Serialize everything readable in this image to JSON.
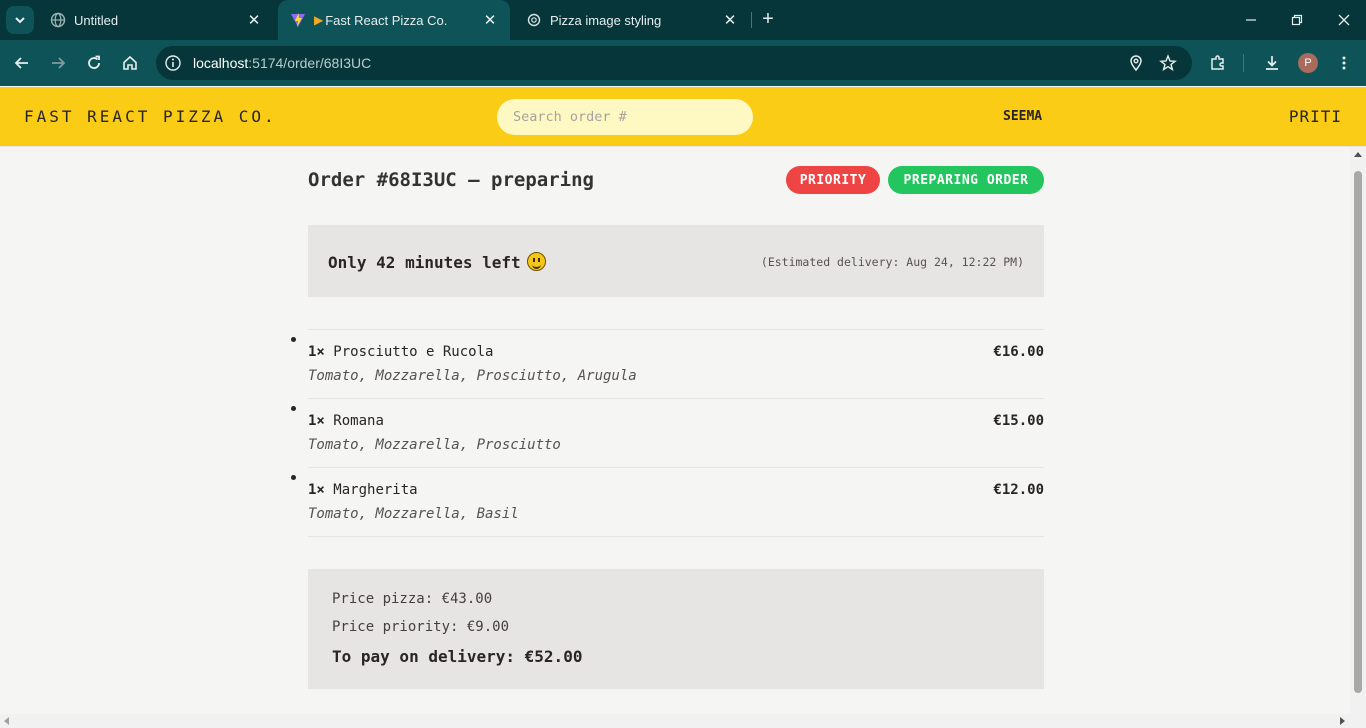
{
  "browser": {
    "tabs": [
      {
        "title": "Untitled",
        "icon": "globe-icon",
        "active": false
      },
      {
        "title": "Fast React Pizza Co.",
        "icon": "vite-icon",
        "active": true
      },
      {
        "title": "Pizza image styling",
        "icon": "openai-icon",
        "active": false
      }
    ],
    "url_host": "localhost",
    "url_path": ":5174/order/68I3UC",
    "profile_initial": "P"
  },
  "header": {
    "logo": "FAST REACT PIZZA CO.",
    "search_placeholder": "Search order #",
    "username": "SEEMA",
    "username_secondary": "PRITI"
  },
  "order": {
    "title": "Order #68I3UC — preparing",
    "priority_badge": "PRIORITY",
    "status_badge": "PREPARING ORDER",
    "eta": "Only 42 minutes left",
    "eta_emoji": "grinning-face-emoji",
    "estimated_delivery": "(Estimated delivery: Aug 24, 12:22 PM)",
    "items": [
      {
        "qty": "1×",
        "name": "Prosciutto e Rucola",
        "price": "€16.00",
        "ingredients": "Tomato, Mozzarella, Prosciutto, Arugula"
      },
      {
        "qty": "1×",
        "name": "Romana",
        "price": "€15.00",
        "ingredients": "Tomato, Mozzarella, Prosciutto"
      },
      {
        "qty": "1×",
        "name": "Margherita",
        "price": "€12.00",
        "ingredients": "Tomato, Mozzarella, Basil"
      }
    ],
    "price_pizza": "Price pizza: €43.00",
    "price_priority": "Price priority: €9.00",
    "total": "To pay on delivery: €52.00"
  },
  "colors": {
    "header_bg": "#facc15",
    "priority": "#ef4444",
    "status": "#22c55e",
    "chrome_dark": "#06363a",
    "chrome_toolbar": "#0e5358"
  }
}
